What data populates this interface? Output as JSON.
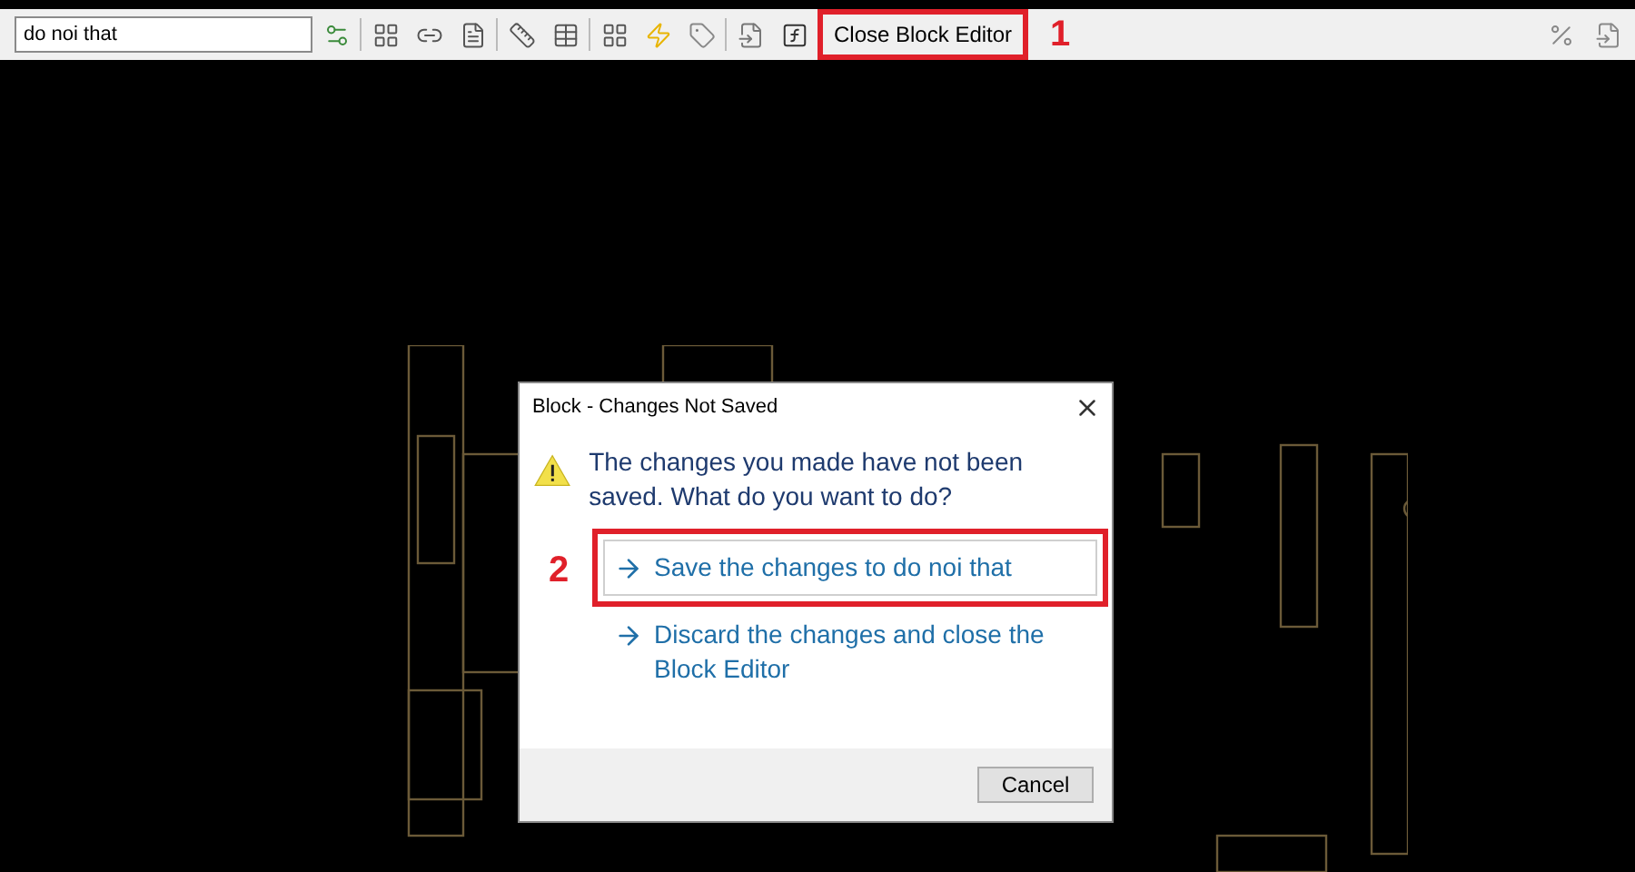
{
  "toolbar": {
    "block_name": "do noi that",
    "close_button": "Close Block Editor"
  },
  "callouts": [
    {
      "label": "1"
    },
    {
      "label": "2"
    }
  ],
  "dialog": {
    "title": "Block - Changes Not Saved",
    "message": "The changes you made have not been saved. What do you want to do?",
    "options": [
      {
        "label": "Save the changes to do noi that",
        "highlighted": true,
        "framed": true
      },
      {
        "label": "Discard the changes and close the Block Editor",
        "highlighted": false,
        "framed": false
      }
    ],
    "cancel": "Cancel"
  }
}
